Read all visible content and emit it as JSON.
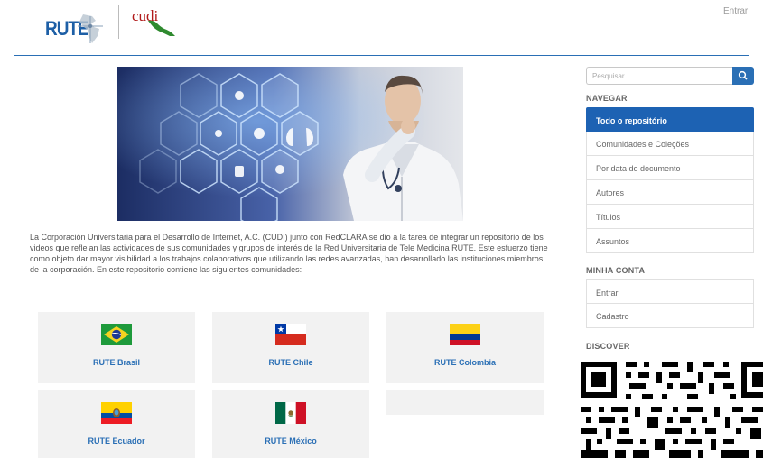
{
  "header": {
    "logo_rute_text": "RUTE",
    "logo_cudi_text": "cudi",
    "login_link": "Entrar"
  },
  "main": {
    "intro_text": "La Corporación Universitaria para el Desarrollo de Internet, A.C. (CUDI) junto con RedCLARA se dio a la tarea de integrar un repositorio de los videos que reflejan las actividades de sus comunidades y grupos de interés de la Red Universitaria de Tele Medicina RUTE. Este esfuerzo tiene como objeto dar mayor visibilidad a los trabajos colaborativos que utilizando las redes avanzadas, han desarrollado las instituciones miembros de la corporación. En este repositorio contiene las siguientes comunidades:",
    "communities": [
      {
        "name": "RUTE Brasil",
        "flag": "brazil-flag"
      },
      {
        "name": "RUTE Chile",
        "flag": "chile-flag"
      },
      {
        "name": "RUTE Colombia",
        "flag": "colombia-flag"
      },
      {
        "name": "RUTE Ecuador",
        "flag": "ecuador-flag"
      },
      {
        "name": "RUTE México",
        "flag": "mexico-flag"
      }
    ]
  },
  "sidebar": {
    "search_placeholder": "Pesquisar",
    "navegar_heading": "NAVEGAR",
    "nav_items": [
      {
        "label": "Todo o repositório",
        "active": true
      },
      {
        "label": "Comunidades e Coleções"
      },
      {
        "label": "Por data do documento"
      },
      {
        "label": "Autores"
      },
      {
        "label": "Títulos"
      },
      {
        "label": "Assuntos"
      }
    ],
    "minha_conta_heading": "MINHA CONTA",
    "account_items": [
      {
        "label": "Entrar"
      },
      {
        "label": "Cadastro"
      }
    ],
    "discover_heading": "DISCOVER"
  },
  "colors": {
    "accent": "#2a6fb5",
    "active_nav": "#1d62b3",
    "card_bg": "#f2f2f2"
  }
}
